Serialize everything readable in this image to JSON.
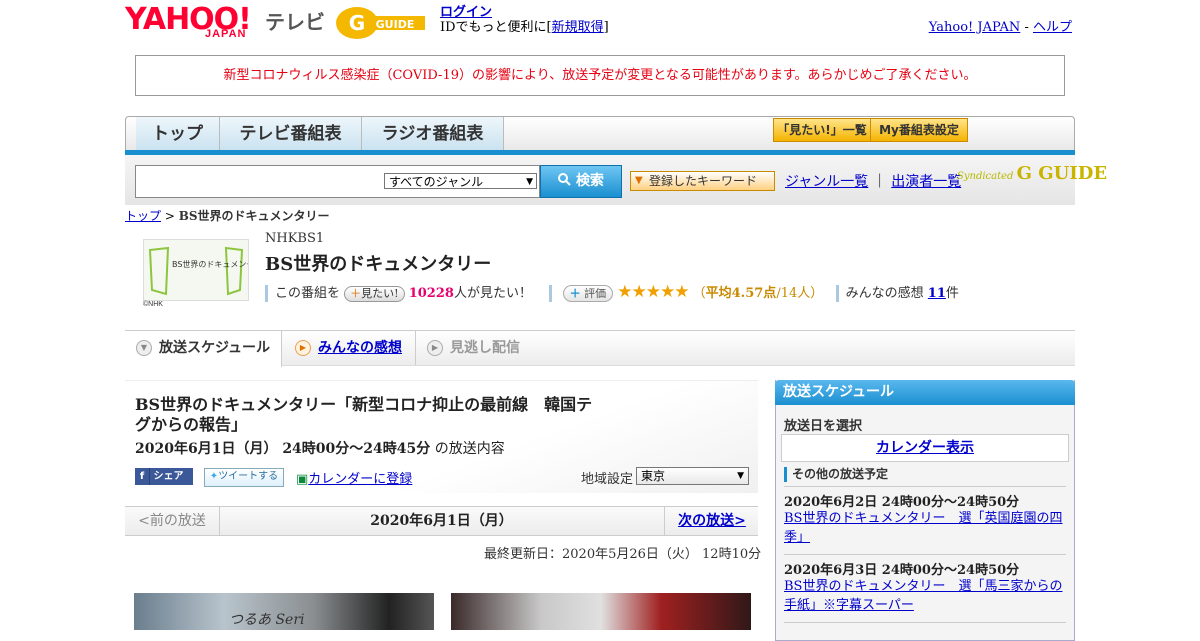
{
  "header": {
    "logo_yahoo": "YAHOO!",
    "logo_japan": "JAPAN",
    "logo_tv": "テレビ",
    "gguide_logo": "G GUIDE",
    "login_link": "ログイン",
    "login_text_prefix": "IDでもっと便利に[",
    "register_link": "新規取得",
    "login_text_suffix": "]",
    "yahoo_japan_link": "Yahoo! JAPAN",
    "link_sep": " - ",
    "help_link": "ヘルプ"
  },
  "notice": "新型コロナウィルス感染症（COVID-19）の影響により、放送予定が変更となる可能性があります。あらかじめご了承ください。",
  "nav": {
    "tabs": [
      "トップ",
      "テレビ番組表",
      "ラジオ番組表"
    ],
    "mitai_list": "「見たい!」一覧",
    "my_settings": "My番組表設定"
  },
  "search": {
    "genre_selected": "すべてのジャンル",
    "button": "検索",
    "registered_keyword": "登録したキーワード",
    "genre_list": "ジャンル一覧",
    "separator": "｜",
    "performer_list": "出演者一覧",
    "syndicated": "Syndicated",
    "gguide_small": "G GUIDE"
  },
  "breadcrumb": {
    "top": "トップ",
    "sep": " > ",
    "current": "BS世界のドキュメンタリー"
  },
  "program": {
    "thumb_text": "BS世界のドキュメンタリー",
    "thumb_credit": "©NHK",
    "channel": "NHKBS1",
    "title": "BS世界のドキュメンタリー",
    "mitai_prefix": "この番組を",
    "mitai_btn": "見たい!",
    "mitai_count": "10228",
    "mitai_suffix": "人が見たい！",
    "hyoka_btn": "評価",
    "stars": "★★★★★",
    "avg_prefix": "（",
    "avg_value": "平均4.57点",
    "avg_suffix": "/14人）",
    "impressions_prefix": "みんなの感想 ",
    "impressions_count": "11",
    "impressions_suffix": "件"
  },
  "tabs": {
    "schedule": "放送スケジュール",
    "reviews": "みんなの感想",
    "missed": "見逃し配信"
  },
  "episode": {
    "title": "BS世界のドキュメンタリー「新型コロナ抑止の最前線　韓国テグからの報告」",
    "date": "2020年6月1日（月）  24時00分～24時45分",
    "date_suffix": " の放送内容",
    "fb_share": "シェア",
    "tweet": "ツイートする",
    "calendar_register": "カレンダーに登録",
    "region_label": "地域設定",
    "region_value": "東京",
    "prev": "<前の放送",
    "current_date": "2020年6月1日（月）",
    "next": "次の放送>",
    "updated": "最終更新日：2020年5月26日（火）  12時10分",
    "img1_text": "つるあ Seri"
  },
  "sidebar": {
    "header": "放送スケジュール",
    "select_label": "放送日を選択",
    "calendar_link": "カレンダー表示",
    "other_label": "その他の放送予定",
    "items": [
      {
        "date": "2020年6月2日  24時00分～24時50分",
        "title": "BS世界のドキュメンタリー　選「英国庭園の四季」"
      },
      {
        "date": "2020年6月3日  24時00分～24時50分",
        "title": "BS世界のドキュメンタリー　選「馬三家からの手紙」※字幕スーパー"
      }
    ]
  },
  "colors": {
    "accent_blue": "#1a8fd0",
    "notice_red": "#e60012",
    "star_orange": "#f0a000",
    "pink": "#e8006d"
  }
}
